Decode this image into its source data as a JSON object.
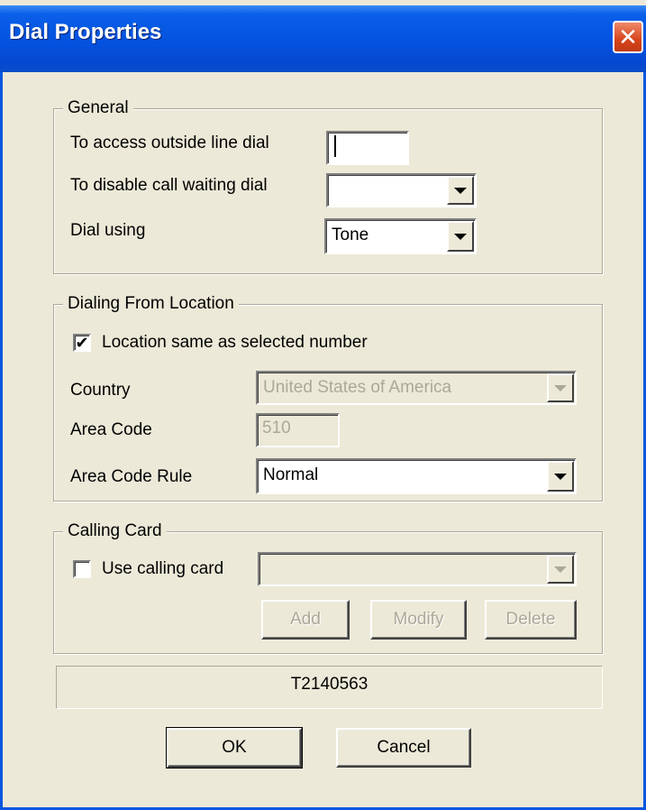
{
  "window": {
    "title": "Dial Properties",
    "close_glyph": "✕"
  },
  "general": {
    "title": "General",
    "outside_line_label": "To access outside line dial",
    "outside_line_value": "",
    "call_waiting_label": "To disable call waiting dial",
    "call_waiting_value": "",
    "dial_using_label": "Dial using",
    "dial_using_value": "Tone"
  },
  "location": {
    "title": "Dialing From Location",
    "same_as_selected_label": "Location same as selected number",
    "same_as_selected_checked": true,
    "check_glyph": "✔",
    "country_label": "Country",
    "country_value": "United States of America",
    "area_code_label": "Area Code",
    "area_code_value": "510",
    "area_code_rule_label": "Area Code Rule",
    "area_code_rule_value": "Normal"
  },
  "calling_card": {
    "title": "Calling Card",
    "use_label": "Use calling card",
    "use_checked": false,
    "card_value": "",
    "add_label": "Add",
    "modify_label": "Modify",
    "delete_label": "Delete"
  },
  "status": {
    "text": "T2140563"
  },
  "buttons": {
    "ok_label": "OK",
    "cancel_label": "Cancel"
  },
  "colors": {
    "title_bar": "#0553e0",
    "dialog_bg": "#ece9d8",
    "close_button": "#d6441c",
    "disabled_text": "#aca899"
  }
}
